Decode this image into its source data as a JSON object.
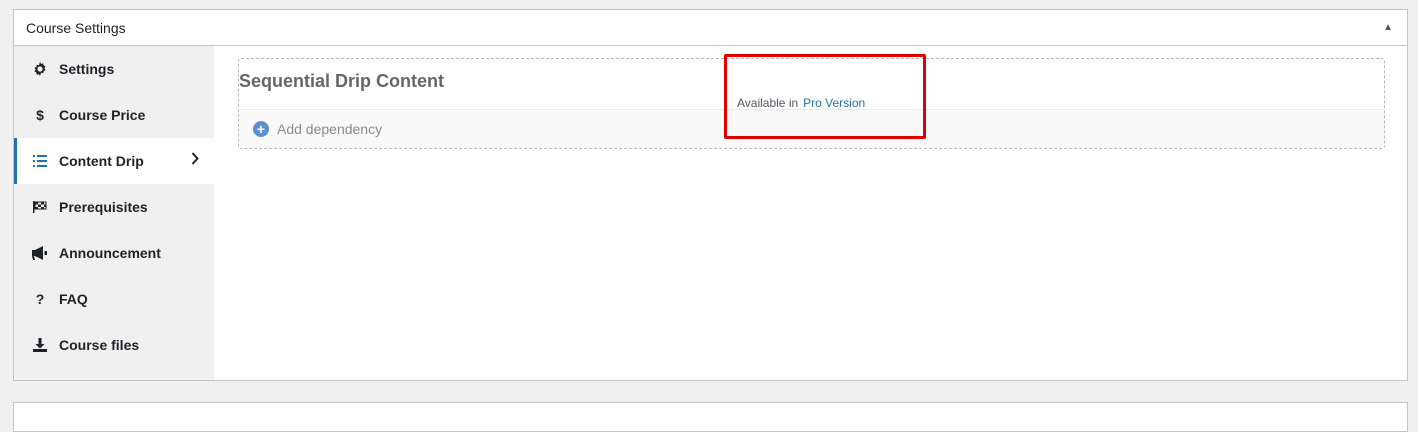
{
  "panel": {
    "title": "Course Settings"
  },
  "tabs": [
    {
      "label": "Settings",
      "icon": "gear-icon"
    },
    {
      "label": "Course Price",
      "icon": "dollar-icon"
    },
    {
      "label": "Content Drip",
      "icon": "list-icon",
      "active": true
    },
    {
      "label": "Prerequisites",
      "icon": "checkered-flag-icon"
    },
    {
      "label": "Announcement",
      "icon": "megaphone-icon"
    },
    {
      "label": "FAQ",
      "icon": "question-icon"
    },
    {
      "label": "Course files",
      "icon": "download-icon"
    }
  ],
  "drip": {
    "title": "Sequential Drip Content",
    "add_dependency": "Add dependency"
  },
  "pro_notice": {
    "text": "Available in",
    "link": "Pro Version"
  },
  "colors": {
    "accent": "#2271b1",
    "highlight": "#e00000",
    "add_icon": "#5e8fd0"
  }
}
